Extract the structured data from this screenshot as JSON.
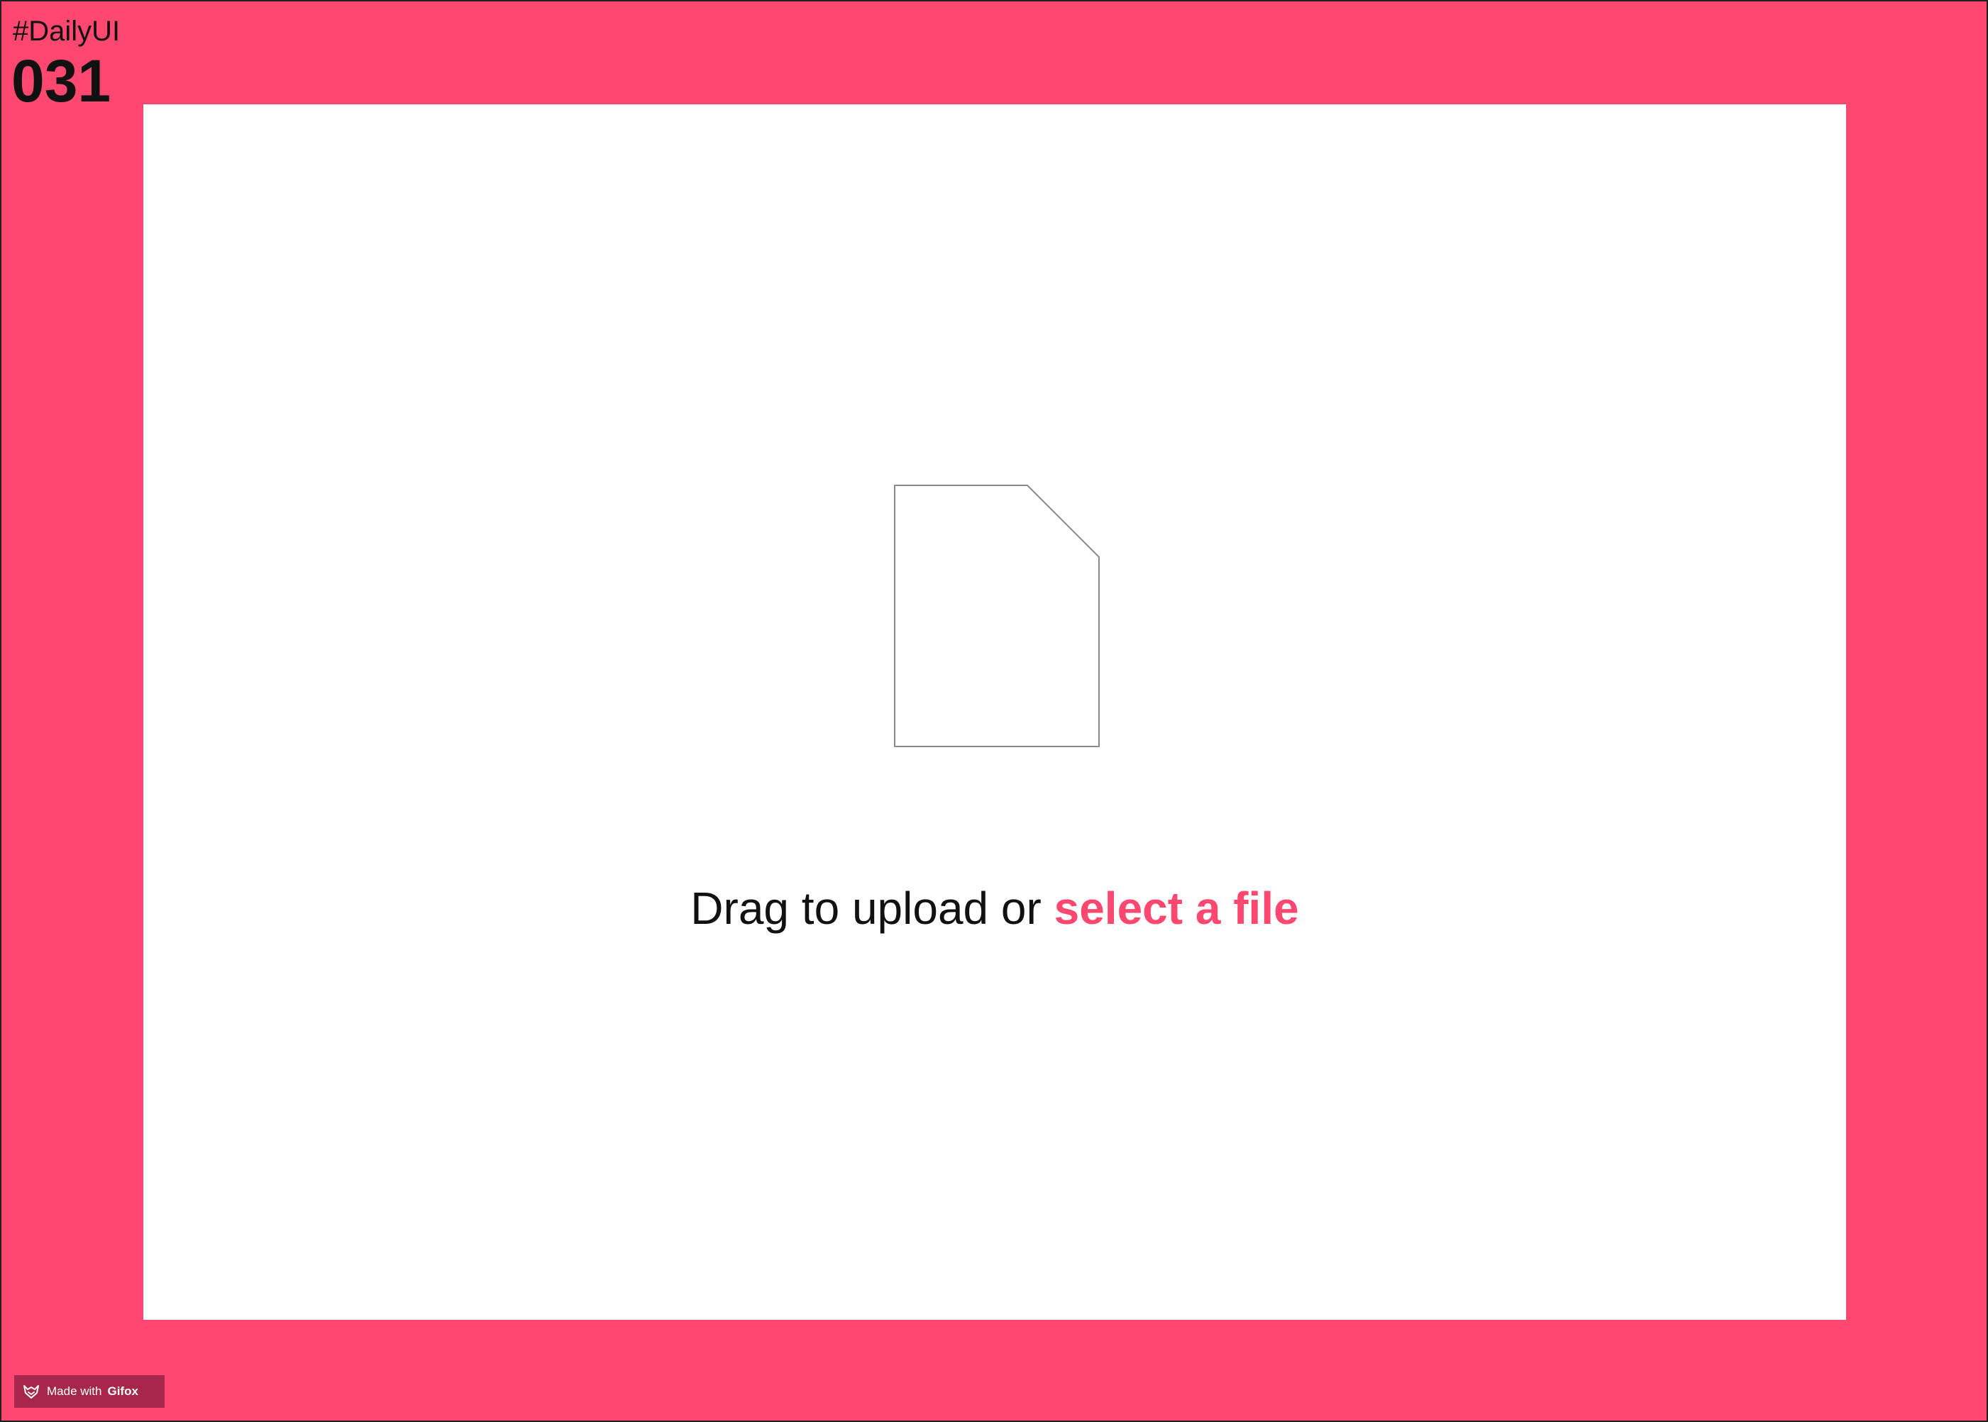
{
  "header": {
    "brand_tag": "#DailyUI",
    "day_number": "031"
  },
  "upload": {
    "prefix": "Drag to upload or ",
    "link_label": "select a file"
  },
  "watermark": {
    "prefix": "Made with ",
    "brand": "Gifox"
  },
  "colors": {
    "accent": "#ff4870",
    "card": "#ffffff",
    "text": "#111111",
    "watermark_bg": "#a6274b"
  },
  "icons": {
    "file": "file-icon",
    "watermark": "fox-logo-icon"
  }
}
